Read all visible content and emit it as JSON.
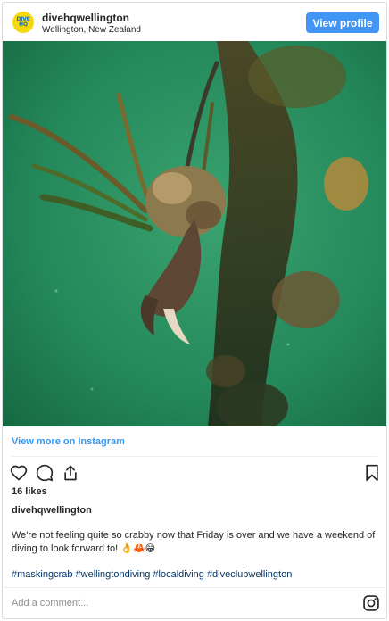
{
  "header": {
    "avatar_text_line1": "DIVE",
    "avatar_text_line2": "HQ",
    "account_name": "divehqwellington",
    "location": "Wellington, New Zealand",
    "view_profile_label": "View profile"
  },
  "photo": {
    "subject_colors": {
      "water": "#23875a",
      "water_light": "#2f9d68",
      "rope": "#3a2e18",
      "crab": "#5e4634",
      "claw_tip": "#e6d8c2"
    }
  },
  "links": {
    "view_more": "View more on Instagram"
  },
  "actions": {
    "icons": [
      "heart-icon",
      "comment-icon",
      "share-icon",
      "bookmark-icon"
    ]
  },
  "post": {
    "likes": "16 likes",
    "owner": "divehqwellington",
    "caption": "We're not feeling quite so crabby now that Friday is over and we have a weekend of diving to look forward to! 👌🦀😁",
    "hashtags": [
      "#maskingcrab",
      "#wellingtondiving",
      "#localdiving",
      "#diveclubwellington"
    ]
  },
  "comment": {
    "placeholder": "Add a comment..."
  },
  "colors": {
    "accent": "#4195f5",
    "link": "#3897f0",
    "hashtag": "#00376b"
  }
}
